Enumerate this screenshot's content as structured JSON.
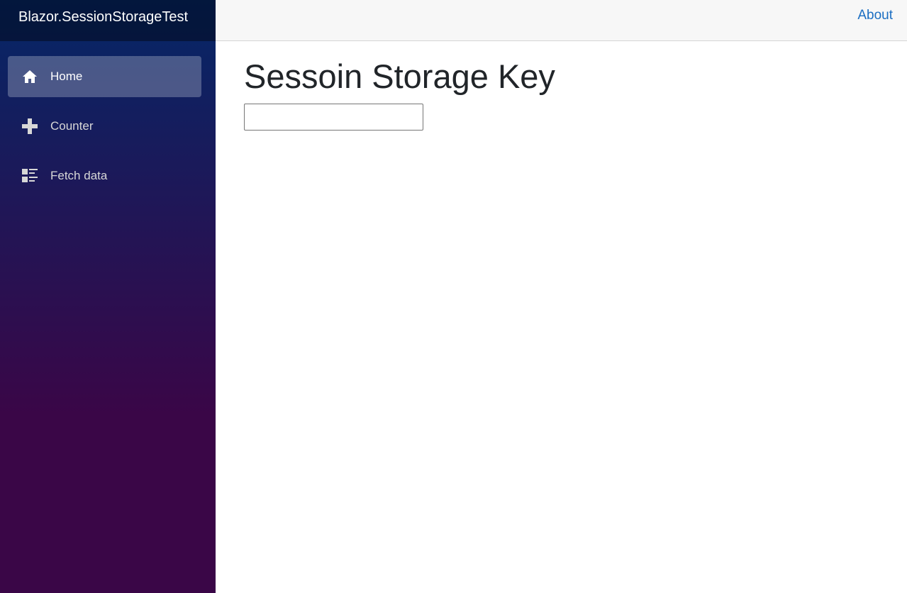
{
  "app": {
    "brand": "Blazor.SessionStorageTest"
  },
  "sidebar": {
    "items": [
      {
        "label": "Home",
        "icon": "home-icon",
        "active": true
      },
      {
        "label": "Counter",
        "icon": "plus-icon",
        "active": false
      },
      {
        "label": "Fetch data",
        "icon": "list-rich-icon",
        "active": false
      }
    ]
  },
  "header": {
    "about_label": "About"
  },
  "main": {
    "title": "Sessoin Storage Key",
    "input": {
      "value": "",
      "placeholder": ""
    }
  },
  "colors": {
    "sidebar_gradient_top": "#052767",
    "sidebar_gradient_bottom": "#3a0647",
    "link": "#1b6ec2",
    "top_row_bg": "#f7f7f7"
  }
}
